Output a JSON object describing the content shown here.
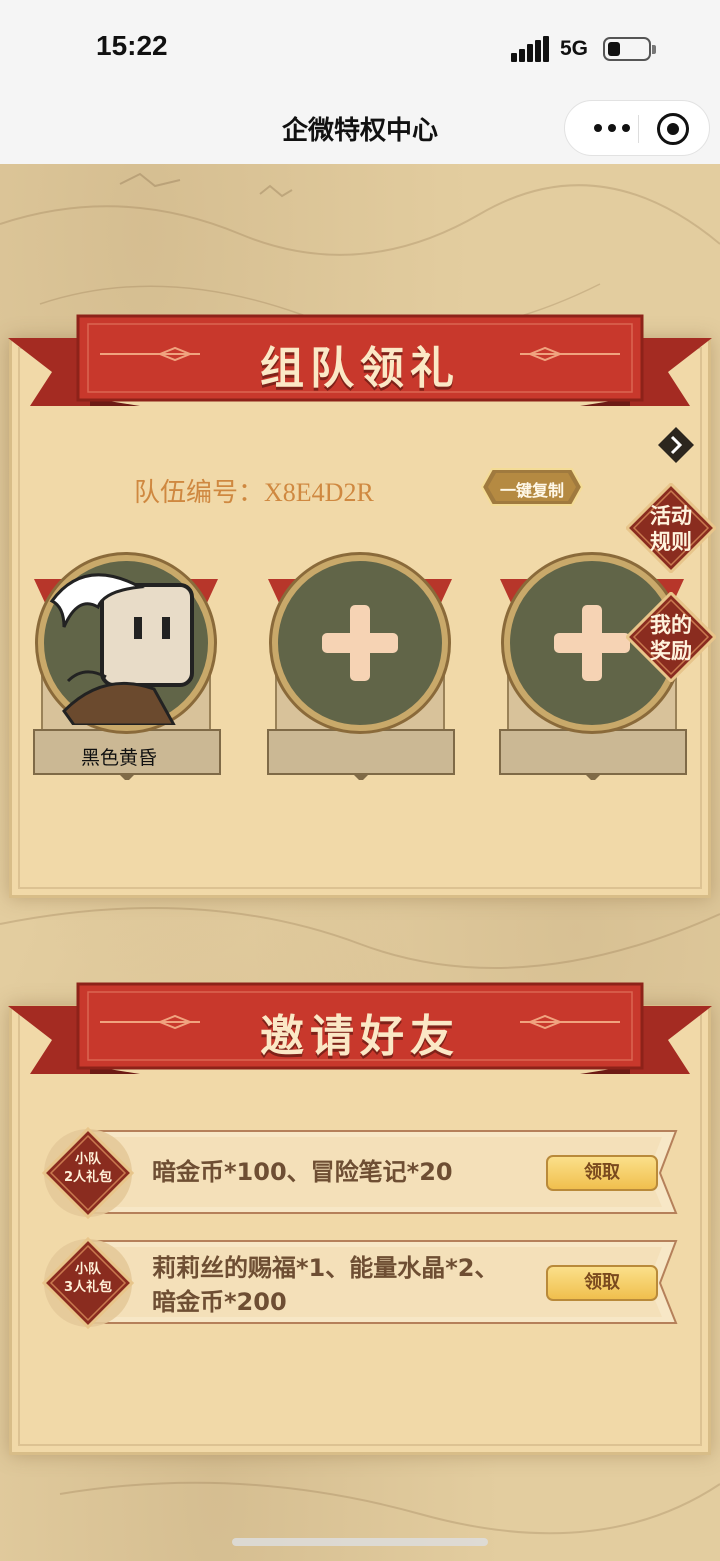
{
  "status": {
    "time": "15:22",
    "network": "5G",
    "battery_level": 0.3
  },
  "nav": {
    "title": "企微特权中心"
  },
  "team_section": {
    "title": "组队领礼",
    "team_id_label": "队伍编号：",
    "team_id": "X8E4D2R",
    "copy_button": "一键复制",
    "side_buttons": [
      {
        "line1": "活动",
        "line2": "规则"
      },
      {
        "line1": "我的",
        "line2": "奖励"
      }
    ],
    "members": [
      {
        "name": "黑色黄昏",
        "filled": true
      },
      {
        "name": "",
        "filled": false
      },
      {
        "name": "",
        "filled": false
      }
    ]
  },
  "invite_section": {
    "title": "邀请好友",
    "packs": [
      {
        "badge_line1": "小队",
        "badge_line2": "2人礼包",
        "reward_line1": "暗金币*100、冒险笔记*20",
        "reward_line2": "",
        "button": "领取"
      },
      {
        "badge_line1": "小队",
        "badge_line2": "3人礼包",
        "reward_line1": "莉莉丝的赐福*1、能量水晶*2、",
        "reward_line2": "暗金币*200",
        "button": "领取"
      }
    ]
  },
  "colors": {
    "ribbon_red": "#c8382c",
    "parchment": "#f1d9a8",
    "slot_green": "#616548",
    "accent_orange": "#cf8840"
  }
}
